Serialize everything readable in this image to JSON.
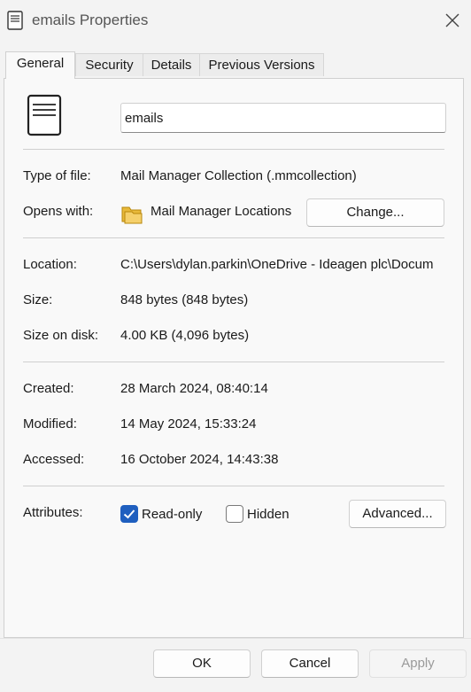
{
  "window": {
    "title": "emails Properties"
  },
  "tabs": [
    "General",
    "Security",
    "Details",
    "Previous Versions"
  ],
  "general": {
    "file_name": "emails",
    "type_label": "Type of file:",
    "type_value": "Mail Manager Collection (.mmcollection)",
    "opens_label": "Opens with:",
    "opens_value": "Mail Manager Locations",
    "change_button": "Change...",
    "location_label": "Location:",
    "location_value": "C:\\Users\\dylan.parkin\\OneDrive - Ideagen plc\\Docum",
    "size_label": "Size:",
    "size_value": "848 bytes (848 bytes)",
    "size_disk_label": "Size on disk:",
    "size_disk_value": "4.00 KB (4,096 bytes)",
    "created_label": "Created:",
    "created_value": "28 March 2024, 08:40:14",
    "modified_label": "Modified:",
    "modified_value": "14 May 2024, 15:33:24",
    "accessed_label": "Accessed:",
    "accessed_value": "16 October 2024, 14:43:38",
    "attributes_label": "Attributes:",
    "readonly_label": "Read-only",
    "readonly_checked": true,
    "hidden_label": "Hidden",
    "hidden_checked": false,
    "advanced_button": "Advanced..."
  },
  "footer": {
    "ok": "OK",
    "cancel": "Cancel",
    "apply": "Apply"
  },
  "colors": {
    "accent": "#1f5fbf",
    "folder": "#e8b93a"
  },
  "icons": [
    "document-icon",
    "close-icon",
    "folder-icon",
    "checkmark-icon"
  ]
}
